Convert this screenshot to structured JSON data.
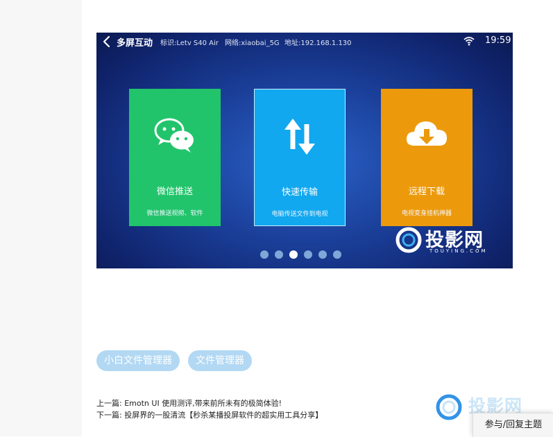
{
  "tv": {
    "title": "多屏互动",
    "device_id": "标识:Letv S40 Air",
    "network": "网络:xiaobai_5G",
    "address": "地址:192.168.1.130",
    "time": "19:59",
    "cards": [
      {
        "title": "微信推送",
        "subtitle": "微信推送视频、软件",
        "color": "#21c46b",
        "icon": "wechat-icon"
      },
      {
        "title": "快速传输",
        "subtitle": "电脑传送文件到电视",
        "color": "#11a8ef",
        "icon": "sync-arrows-icon"
      },
      {
        "title": "远程下载",
        "subtitle": "电视变身挂机神器",
        "color": "#ec9a0c",
        "icon": "cloud-download-icon"
      }
    ],
    "carousel": {
      "total": 6,
      "active_index": 2
    },
    "watermark": {
      "name": "投影网",
      "domain": "TOUYING.COM"
    }
  },
  "tags": [
    "小白文件管理器",
    "文件管理器"
  ],
  "nav": {
    "prev_label": "上一篇:",
    "prev_title": "Emotn UI 使用测评,带来前所未有的极简体验!",
    "next_label": "下一篇:",
    "next_title": "投屏界的一股清流【秒杀某播投屏软件的超实用工具分享】"
  },
  "footer_watermark": "投影网",
  "reply_button": "参与/回复主题",
  "colors": {
    "tag_bg": "#b2d8f3",
    "tv_bg": "#1a3e98",
    "accent": "#1e88e5"
  }
}
